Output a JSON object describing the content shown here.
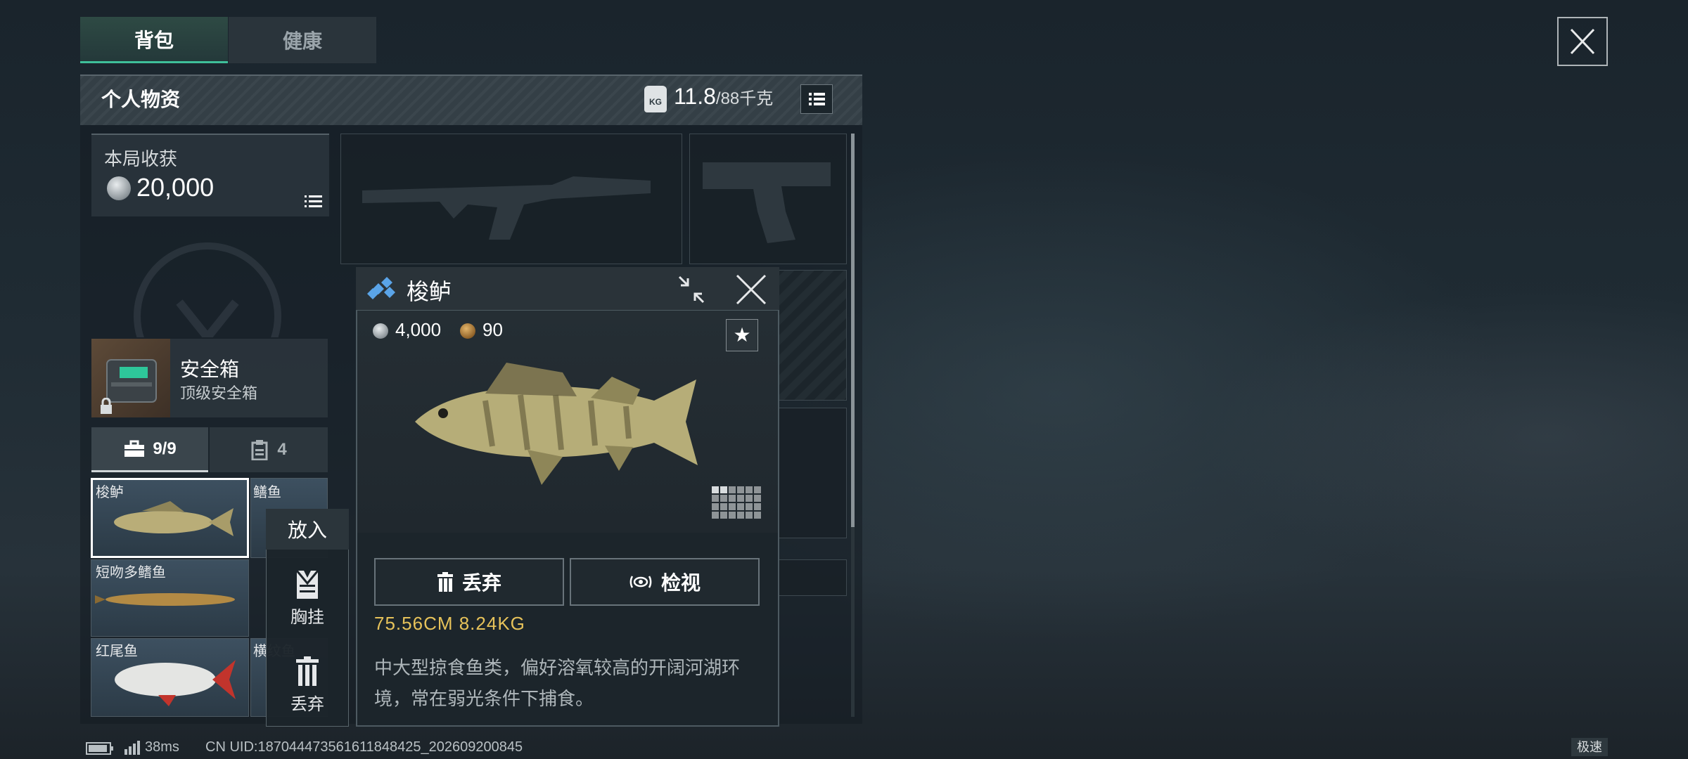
{
  "tabs": [
    {
      "label": "背包"
    },
    {
      "label": "健康"
    }
  ],
  "inventory": {
    "title": "个人物资",
    "weight_current": "11.8",
    "weight_max": "/88千克",
    "weight_icon": "KG"
  },
  "harvest": {
    "label": "本局收获",
    "value": "20,000"
  },
  "secure_box": {
    "name": "安全箱",
    "subtitle": "顶级安全箱"
  },
  "subtabs": [
    {
      "label": "9/9"
    },
    {
      "label": "4"
    }
  ],
  "fish_grid": {
    "items": [
      {
        "name": "梭鲈"
      },
      {
        "name": "鳝鱼"
      },
      {
        "name": "短吻多鳍鱼"
      },
      {
        "name": "红尾鱼"
      },
      {
        "name": "横纹鱼"
      }
    ]
  },
  "context_menu": {
    "header": "放入",
    "items": [
      {
        "label": "胸挂",
        "icon": "vest-icon"
      },
      {
        "label": "丢弃",
        "icon": "trash-icon"
      }
    ]
  },
  "popup": {
    "title": "梭鲈",
    "price": "4,000",
    "secondary_value": "90",
    "dimensions": "75.56CM  8.24KG",
    "description": "中大型掠食鱼类，偏好溶氧较高的开阔河湖环境，常在弱光条件下捕食。",
    "discard_label": "丢弃",
    "inspect_label": "检视"
  },
  "status_bar": {
    "ping": "38ms",
    "uid": "CN UID:18704447356161184842​5_202609200845",
    "speed": "极速"
  },
  "colors": {
    "accent": "#3fbf9a",
    "dimension_text": "#e6c25a"
  }
}
